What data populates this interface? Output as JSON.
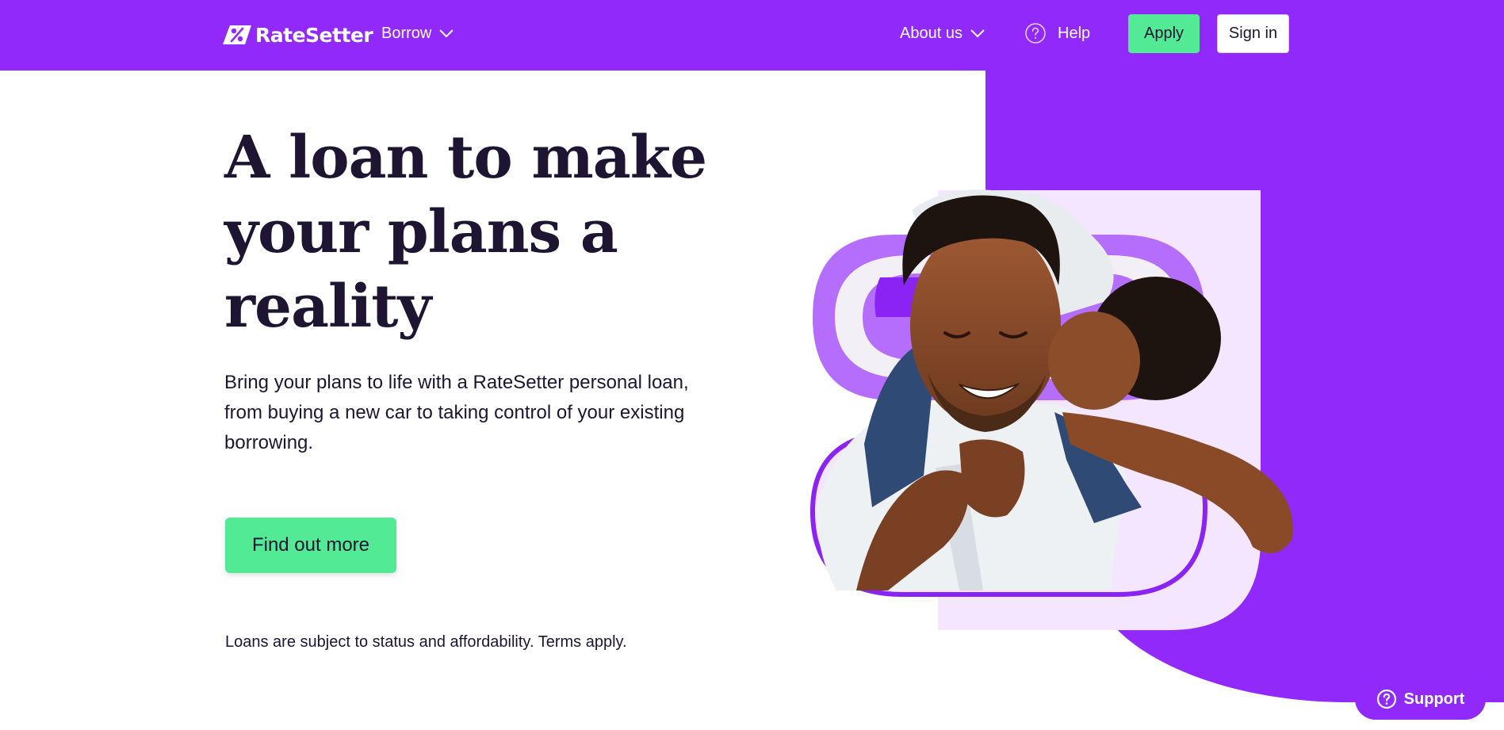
{
  "header": {
    "brand": "RateSetter",
    "nav": {
      "borrow": "Borrow",
      "about": "About us",
      "help": "Help"
    },
    "apply_label": "Apply",
    "signin_label": "Sign in"
  },
  "hero": {
    "title": "A loan to make your plans a reality",
    "subtitle": "Bring your plans to life with a RateSetter personal loan, from buying a new car to taking control of your existing borrowing.",
    "cta_label": "Find out more",
    "disclaimer": "Loans are subject to status and affordability. Terms apply.",
    "image_icon": "father-and-son-photo"
  },
  "support": {
    "label": "Support",
    "icon": "question-circle-icon"
  },
  "colors": {
    "brand_purple": "#9129fb",
    "accent_green": "#52ea95",
    "text_dark": "#1e1533",
    "lavender": "#f3e6fe",
    "light_purple": "#b56dfb"
  }
}
